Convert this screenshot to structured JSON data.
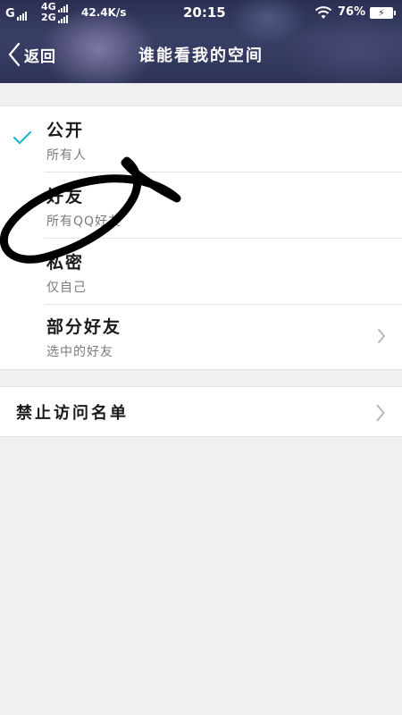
{
  "status_bar": {
    "carrier": "G",
    "network_top": "4G",
    "network_bottom": "2G",
    "speed": "42.4K/s",
    "time": "20:15",
    "battery_percent": "76%"
  },
  "nav": {
    "back_label": "返回",
    "title": "谁能看我的空间"
  },
  "options": [
    {
      "title": "公开",
      "subtitle": "所有人",
      "selected": true
    },
    {
      "title": "好友",
      "subtitle": "所有QQ好友",
      "selected": false
    },
    {
      "title": "私密",
      "subtitle": "仅自己",
      "selected": false
    },
    {
      "title": "部分好友",
      "subtitle": "选中的好友",
      "selected": false
    }
  ],
  "block_list": {
    "label": "禁止访问名单"
  },
  "colors": {
    "check": "#1fb6d0",
    "chevron": "#b5b5b5",
    "scribble": "#000000"
  }
}
